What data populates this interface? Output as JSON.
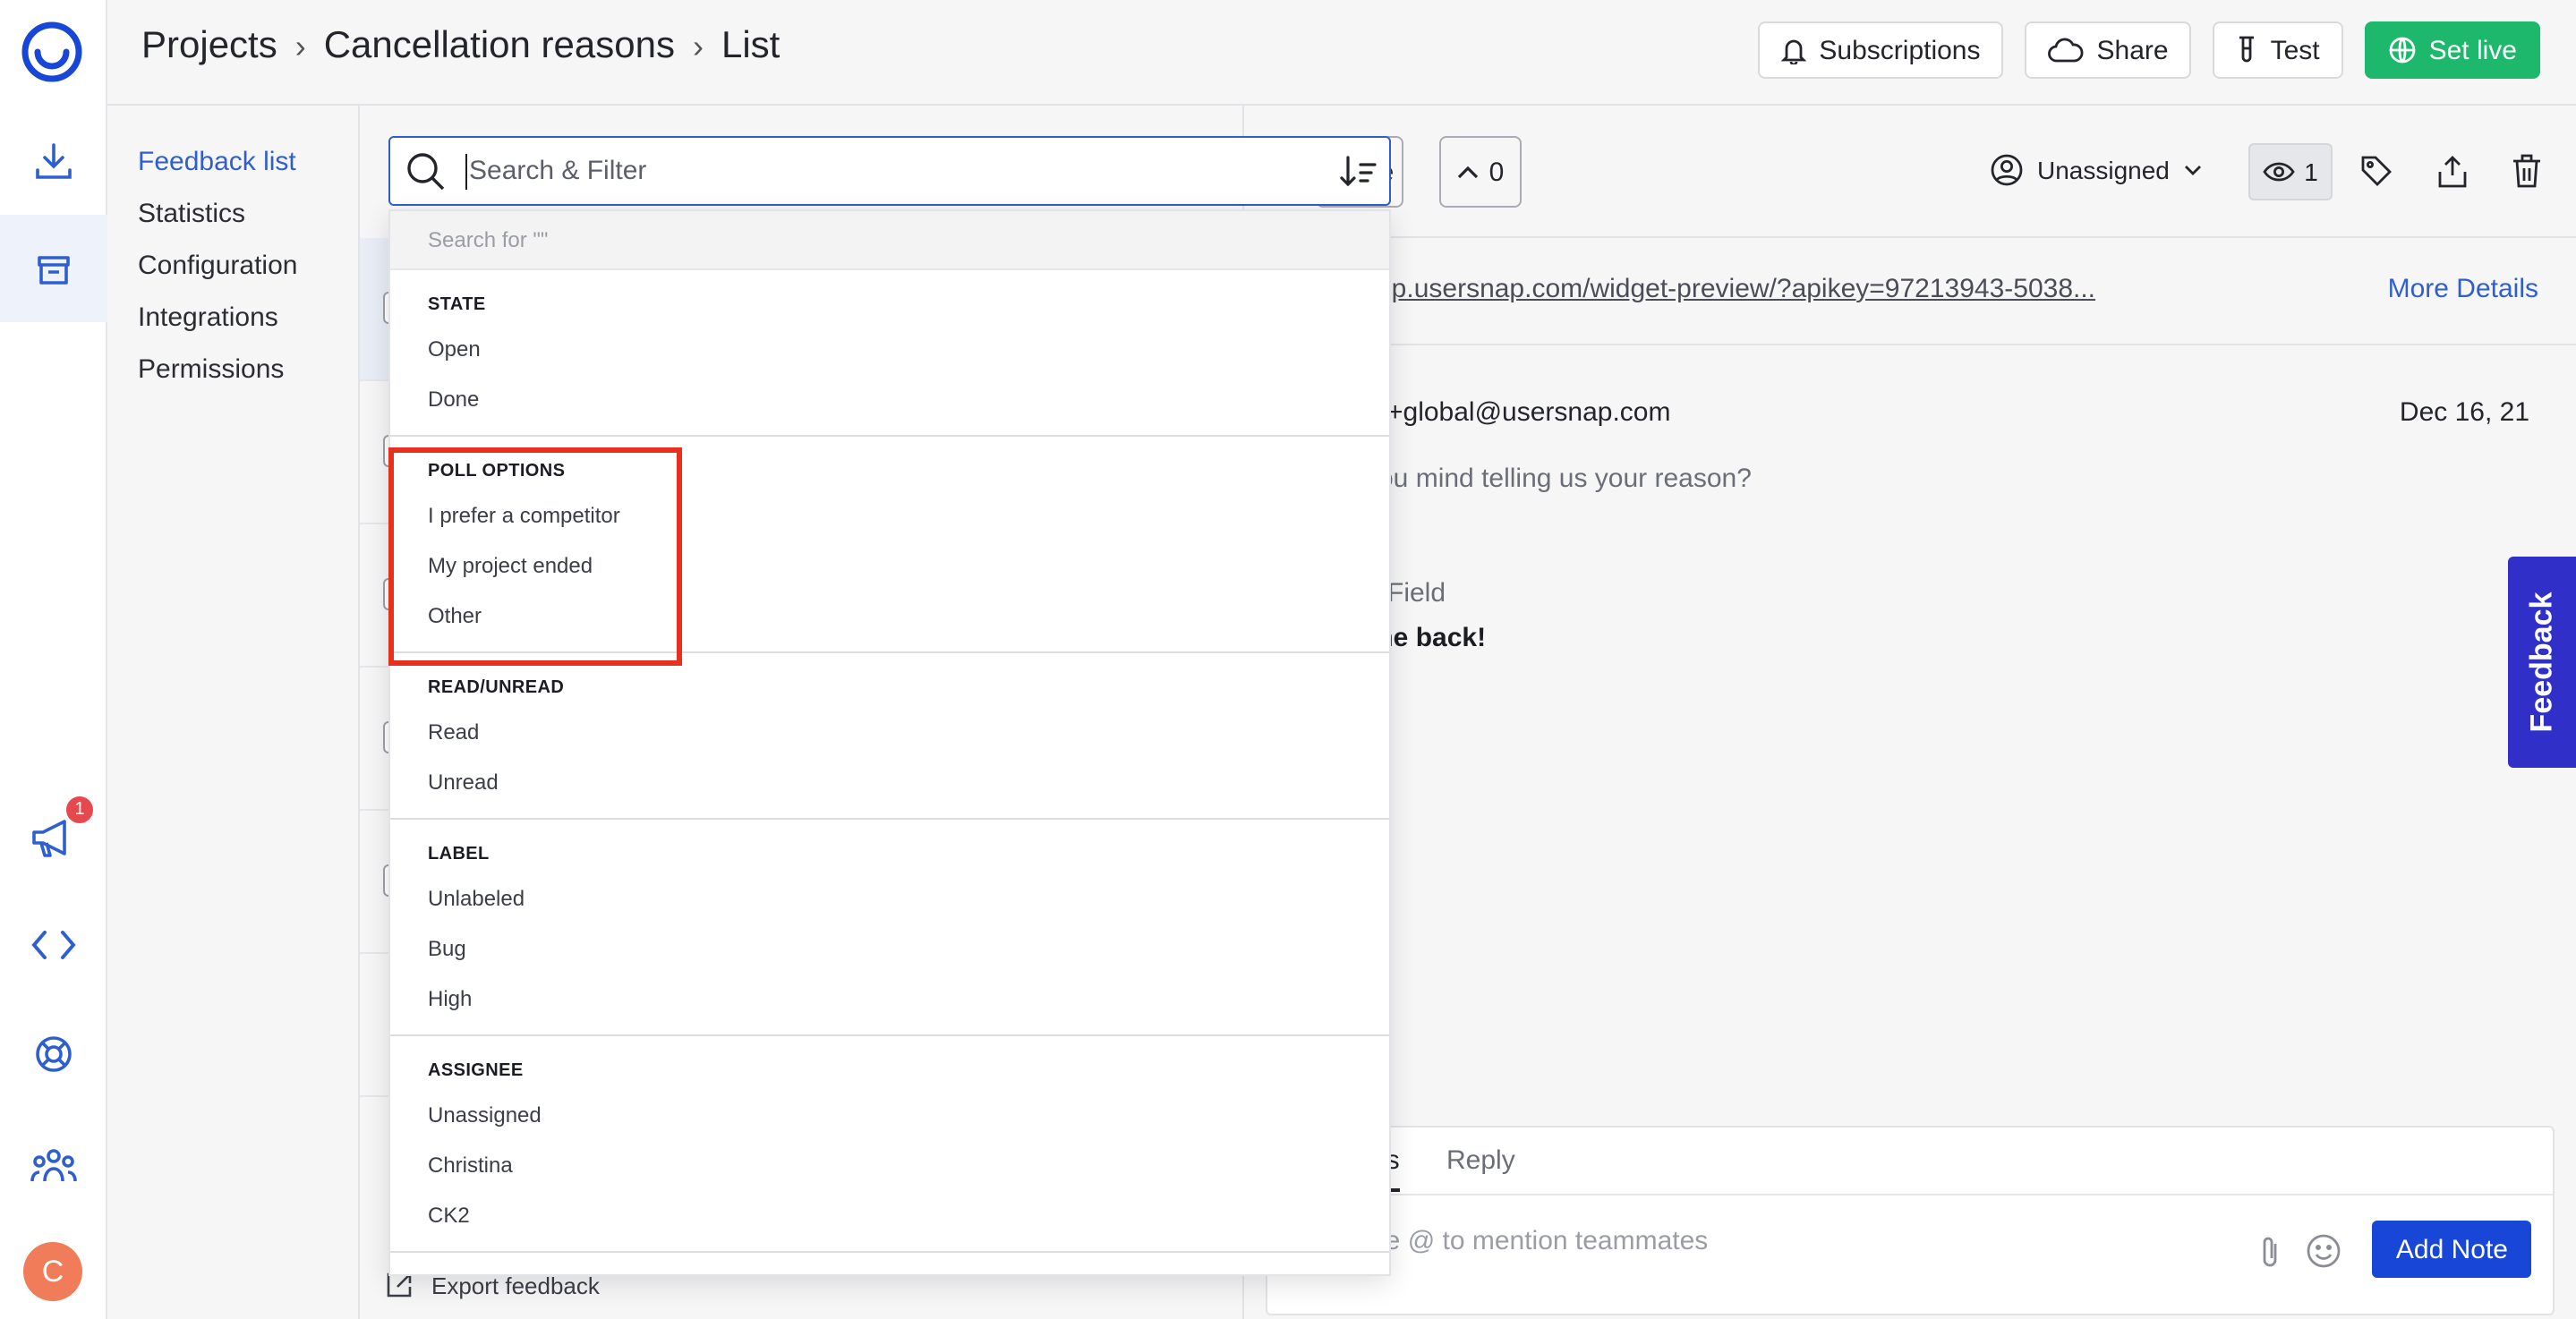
{
  "breadcrumbs": [
    "Projects",
    "Cancellation reasons",
    "List"
  ],
  "toolbar": {
    "subscriptions": "Subscriptions",
    "share": "Share",
    "test": "Test",
    "set_live": "Set live"
  },
  "rail": {
    "notification_count": "1",
    "avatar_initial": "C"
  },
  "subnav": [
    "Feedback list",
    "Statistics",
    "Configuration",
    "Integrations",
    "Permissions"
  ],
  "search": {
    "placeholder": "Search & Filter",
    "search_for": "Search for \"\""
  },
  "filters": [
    {
      "heading": "STATE",
      "items": [
        "Open",
        "Done"
      ]
    },
    {
      "heading": "POLL OPTIONS",
      "items": [
        "I prefer a competitor",
        "My project ended",
        "Other"
      ]
    },
    {
      "heading": "READ/UNREAD",
      "items": [
        "Read",
        "Unread"
      ]
    },
    {
      "heading": "LABEL",
      "items": [
        "Unlabeled",
        "Bug",
        "High"
      ]
    },
    {
      "heading": "ASSIGNEE",
      "items": [
        "Unassigned",
        "Christina",
        "CK2"
      ]
    }
  ],
  "list": {
    "export_label": "Export feedback"
  },
  "detail": {
    "done_partial": "e",
    "upvotes": "0",
    "assignee": "Unassigned",
    "watchers": "1",
    "url": "pp.usersnap.com/widget-preview/?apikey=97213943-5038...",
    "more_details": "More Details",
    "email": "+global@usersnap.com",
    "date": "Dec 16, 21",
    "question": "ou mind telling us your reason?",
    "field_label": "Field",
    "answer": "me back!",
    "tab_notes": "es",
    "tab_reply": "Reply",
    "note_placeholder": "ype @ to mention teammates",
    "add_note": "Add Note"
  },
  "feedback_tab": "Feedback",
  "colors": {
    "accent": "#2f5fcf",
    "live": "#1db86b",
    "highlight": "#e8301f",
    "feedback_tab": "#3030c8"
  }
}
